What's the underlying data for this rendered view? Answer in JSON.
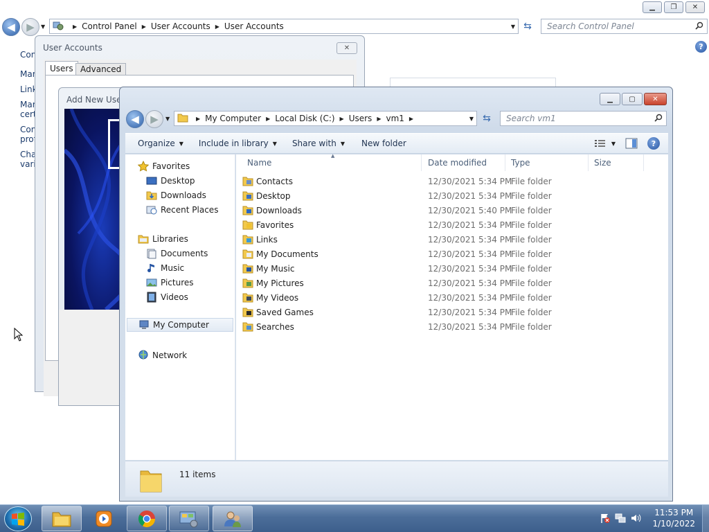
{
  "control_panel": {
    "breadcrumb": [
      "Control Panel",
      "User Accounts",
      "User Accounts"
    ],
    "search_placeholder": "Search Control Panel",
    "side_links": [
      "Con",
      "Mar",
      "Link",
      "Mar\ncert",
      "Con\nprof",
      "Cha\nvaria"
    ]
  },
  "user_accounts": {
    "title": "User Accounts",
    "tabs": [
      "Users",
      "Advanced"
    ]
  },
  "add_new_user": {
    "title": "Add New User"
  },
  "explorer": {
    "breadcrumb": [
      "My Computer",
      "Local Disk (C:)",
      "Users",
      "vm1"
    ],
    "search_placeholder": "Search vm1",
    "toolbar": {
      "organize": "Organize",
      "include_in_library": "Include in library",
      "share_with": "Share with",
      "new_folder": "New folder"
    },
    "nav": {
      "favorites": "Favorites",
      "desktop": "Desktop",
      "downloads": "Downloads",
      "recent_places": "Recent Places",
      "libraries": "Libraries",
      "documents": "Documents",
      "music": "Music",
      "pictures": "Pictures",
      "videos": "Videos",
      "my_computer": "My Computer",
      "network": "Network"
    },
    "columns": {
      "name": "Name",
      "date_modified": "Date modified",
      "type": "Type",
      "size": "Size"
    },
    "files": [
      {
        "name": "Contacts",
        "date": "12/30/2021 5:34 PM",
        "type": "File folder",
        "icon": "contacts-folder-icon"
      },
      {
        "name": "Desktop",
        "date": "12/30/2021 5:34 PM",
        "type": "File folder",
        "icon": "desktop-folder-icon"
      },
      {
        "name": "Downloads",
        "date": "12/30/2021 5:40 PM",
        "type": "File folder",
        "icon": "downloads-folder-icon"
      },
      {
        "name": "Favorites",
        "date": "12/30/2021 5:34 PM",
        "type": "File folder",
        "icon": "favorites-folder-icon"
      },
      {
        "name": "Links",
        "date": "12/30/2021 5:34 PM",
        "type": "File folder",
        "icon": "links-folder-icon"
      },
      {
        "name": "My Documents",
        "date": "12/30/2021 5:34 PM",
        "type": "File folder",
        "icon": "documents-folder-icon"
      },
      {
        "name": "My Music",
        "date": "12/30/2021 5:34 PM",
        "type": "File folder",
        "icon": "music-folder-icon"
      },
      {
        "name": "My Pictures",
        "date": "12/30/2021 5:34 PM",
        "type": "File folder",
        "icon": "pictures-folder-icon"
      },
      {
        "name": "My Videos",
        "date": "12/30/2021 5:34 PM",
        "type": "File folder",
        "icon": "videos-folder-icon"
      },
      {
        "name": "Saved Games",
        "date": "12/30/2021 5:34 PM",
        "type": "File folder",
        "icon": "saved-games-folder-icon"
      },
      {
        "name": "Searches",
        "date": "12/30/2021 5:34 PM",
        "type": "File folder",
        "icon": "searches-folder-icon"
      }
    ],
    "item_count": "11 items"
  },
  "taskbar": {
    "time": "11:53 PM",
    "date": "1/10/2022",
    "apps": [
      "explorer-icon",
      "media-player-icon",
      "chrome-icon",
      "control-panel-icon",
      "user-accounts-icon"
    ]
  },
  "colors": {
    "taskbar": "#4b6d99",
    "folder": "#f2c94c",
    "link": "#1a3a6b",
    "close": "#c9432c"
  }
}
